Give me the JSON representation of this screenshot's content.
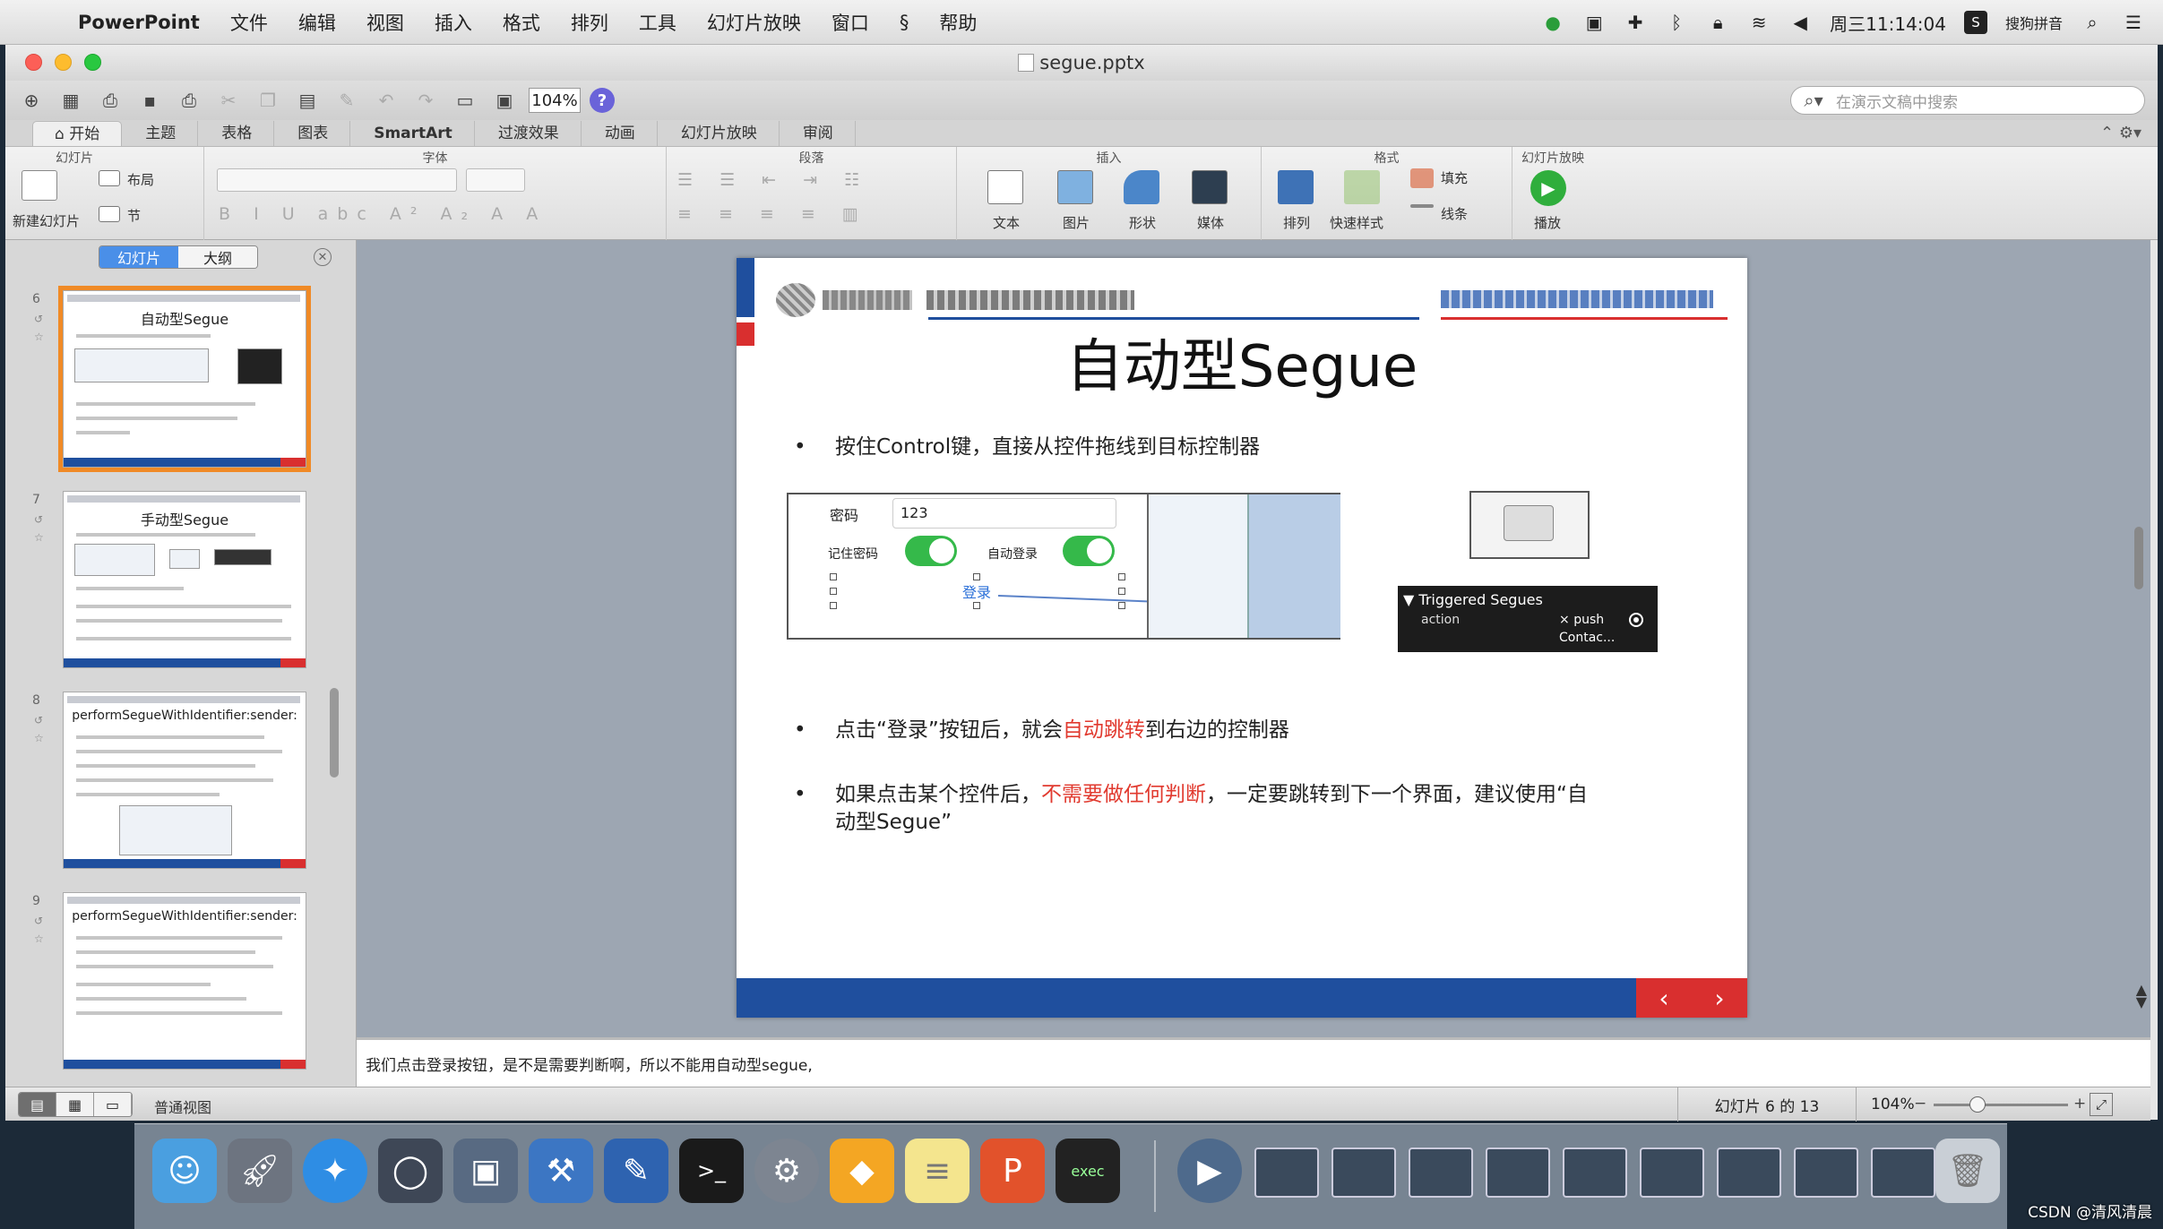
{
  "menubar": {
    "app": "PowerPoint",
    "items": [
      "文件",
      "编辑",
      "视图",
      "插入",
      "格式",
      "排列",
      "工具",
      "幻灯片放映",
      "窗口",
      "帮助"
    ],
    "clock": "周三11:14:04",
    "input_method": "搜狗拼音"
  },
  "window": {
    "title": "segue.pptx"
  },
  "toolbar": {
    "zoom": "104%",
    "search_placeholder": "在演示文稿中搜索"
  },
  "ribbon": {
    "tabs": [
      "开始",
      "主题",
      "表格",
      "图表",
      "SmartArt",
      "过渡效果",
      "动画",
      "幻灯片放映",
      "审阅"
    ],
    "active_tab": "开始",
    "groups": {
      "slides": "幻灯片",
      "font": "字体",
      "paragraph": "段落",
      "insert": "插入",
      "format": "格式",
      "slideshow": "幻灯片放映"
    },
    "labels": {
      "new_slide": "新建幻灯片",
      "layout": "布局",
      "section": "节",
      "text": "文本",
      "picture": "图片",
      "shape": "形状",
      "media": "媒体",
      "arrange": "排列",
      "quick_styles": "快速样式",
      "fill": "填充",
      "line": "线条",
      "play": "播放"
    }
  },
  "left_pane": {
    "tabs": [
      "幻灯片",
      "大纲"
    ],
    "active_tab": "幻灯片",
    "thumbnails": [
      {
        "number": "6",
        "title": "自动型Segue",
        "selected": true
      },
      {
        "number": "7",
        "title": "手动型Segue",
        "selected": false
      },
      {
        "number": "8",
        "title": "performSegueWithIdentifier:sender:",
        "selected": false
      },
      {
        "number": "9",
        "title": "performSegueWithIdentifier:sender:",
        "selected": false
      }
    ]
  },
  "slide": {
    "title": "自动型Segue",
    "bullet1": "按住Control键，直接从控件拖线到目标控制器",
    "bullet2_a": "点击“登录”按钮后，就会",
    "bullet2_red": "自动跳转",
    "bullet2_b": "到右边的控制器",
    "bullet3_a": "如果点击某个控件后，",
    "bullet3_red": "不需要做任何判断",
    "bullet3_b": "，一定要跳转到下一个界面，建议使用“自",
    "bullet3_line2": "动型Segue”",
    "screenshot": {
      "password_label": "密码",
      "password_value": "123",
      "remember_label": "记住密码",
      "autologin_label": "自动登录",
      "login_button": "登录"
    },
    "segues_panel": {
      "header": "Triggered Segues",
      "row_label": "action",
      "row_value": "push",
      "row_target": "Contac..."
    }
  },
  "notes": "我们点击登录按钮，是不是需要判断啊，所以不能用自动型segue,",
  "statusbar": {
    "view_name": "普通视图",
    "slide_info": "幻灯片 6 的 13",
    "zoom": "104%"
  },
  "watermark": "CSDN @清风清晨",
  "colors": {
    "slide_blue": "#1f4f9e",
    "slide_red": "#d92f2f",
    "highlight_red": "#e13a2f",
    "selection_orange": "#f08a26"
  },
  "dock_icons": [
    "finder-icon",
    "launchpad-icon",
    "safari-icon",
    "mouse-icon",
    "photo-slideshow-icon",
    "xcode-icon",
    "instruments-icon",
    "terminal-icon",
    "system-preferences-icon",
    "sketch-icon",
    "notes-icon",
    "powerpoint-icon",
    "console-icon",
    "quicktime-icon",
    "trash-icon"
  ]
}
